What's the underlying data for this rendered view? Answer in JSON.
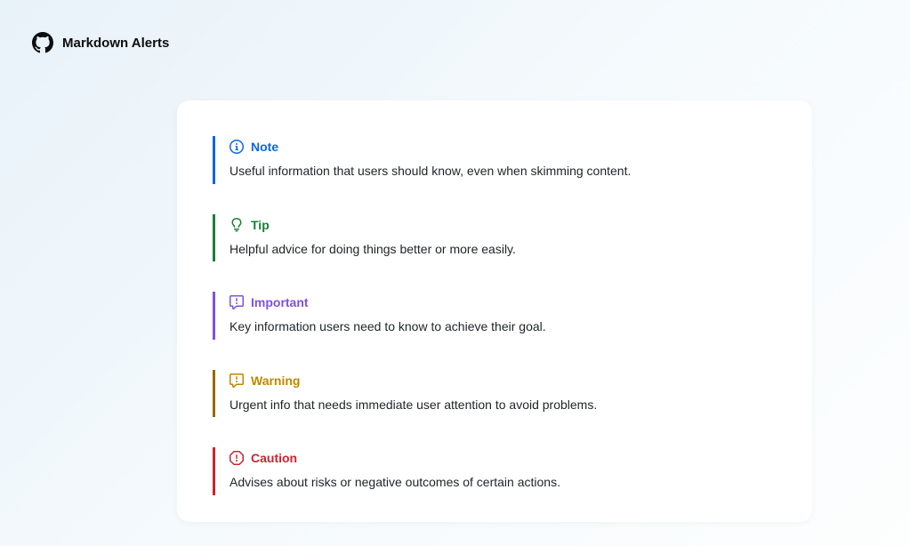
{
  "header": {
    "title": "Markdown Alerts"
  },
  "alerts": [
    {
      "type": "note",
      "title": "Note",
      "body": "Useful information that users should know, even when skimming content."
    },
    {
      "type": "tip",
      "title": "Tip",
      "body": "Helpful advice for doing things better or more easily."
    },
    {
      "type": "important",
      "title": "Important",
      "body": "Key information users need to know to achieve their goal."
    },
    {
      "type": "warning",
      "title": "Warning",
      "body": "Urgent info that needs immediate user attention to avoid problems."
    },
    {
      "type": "caution",
      "title": "Caution",
      "body": "Advises about risks or negative outcomes of certain actions."
    }
  ]
}
